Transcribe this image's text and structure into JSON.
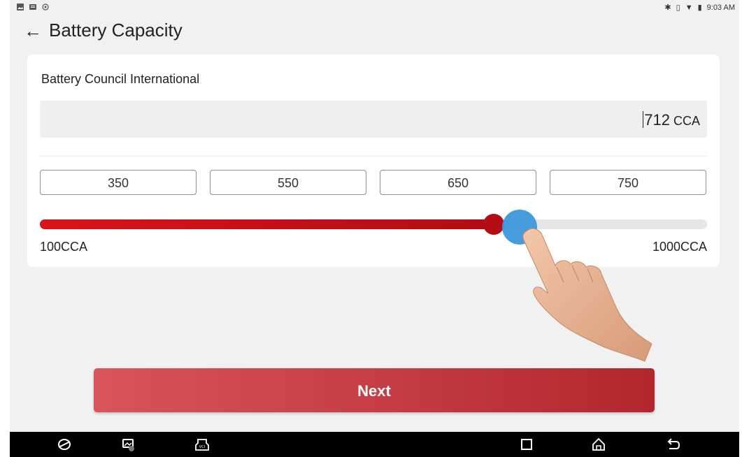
{
  "status_bar": {
    "time": "9:03 AM"
  },
  "header": {
    "back_icon": "back-arrow-icon",
    "title": "Battery Capacity"
  },
  "standard": {
    "label": "Battery Council International"
  },
  "cca": {
    "value": "712",
    "unit": "CCA"
  },
  "presets": [
    {
      "label": "350"
    },
    {
      "label": "550"
    },
    {
      "label": "650"
    },
    {
      "label": "750"
    }
  ],
  "slider": {
    "min_label": "100CCA",
    "max_label": "1000CCA",
    "min": 100,
    "max": 1000,
    "value": 712
  },
  "actions": {
    "next_label": "Next"
  },
  "nav_bar": {
    "icons": [
      "browser-icon",
      "gallery-icon",
      "vci-icon",
      "recent-apps-icon",
      "home-icon",
      "back-icon"
    ]
  },
  "colors": {
    "accent": "#c0141b",
    "button": "#c8373f",
    "touch": "#3d97dc"
  }
}
